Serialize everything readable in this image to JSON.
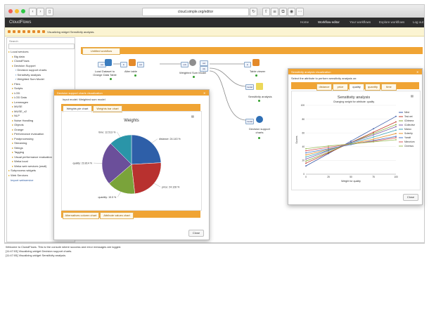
{
  "browser": {
    "url": "cloud.simple.org/editor"
  },
  "app": {
    "brand": "CloudFlows",
    "nav": [
      "Home",
      "Workflow editor",
      "Your workflows",
      "Explore workflows",
      "Log out"
    ],
    "status": "Visualizing widget Sensitivity analysis."
  },
  "sidebar": {
    "search_label": "Search",
    "tree": [
      {
        "label": "Local services",
        "level": 0
      },
      {
        "label": "Big data",
        "level": 1
      },
      {
        "label": "ClowdFlows",
        "level": 1
      },
      {
        "label": "Decision Support",
        "level": 1
      },
      {
        "label": "Decision support charts",
        "level": 2
      },
      {
        "label": "Sensitivity analysis",
        "level": 2
      },
      {
        "label": "Weighted Sum Model",
        "level": 2
      },
      {
        "label": "Files",
        "level": 1
      },
      {
        "label": "Scripts",
        "level": 1
      },
      {
        "label": "LOD",
        "level": 1
      },
      {
        "label": "LOD Data",
        "level": 1
      },
      {
        "label": "Lemmagen",
        "level": 1
      },
      {
        "label": "MUSE",
        "level": 1
      },
      {
        "label": "MUSE_v2",
        "level": 1
      },
      {
        "label": "NLP",
        "level": 1
      },
      {
        "label": "Noise Handling",
        "level": 1
      },
      {
        "label": "Objects",
        "level": 1
      },
      {
        "label": "Orange",
        "level": 1
      },
      {
        "label": "Performance evaluation",
        "level": 1
      },
      {
        "label": "Postprocessing",
        "level": 1
      },
      {
        "label": "Streaming",
        "level": 1
      },
      {
        "label": "Strings",
        "level": 1
      },
      {
        "label": "Tagging",
        "level": 1
      },
      {
        "label": "Visual performance evaluation",
        "level": 1
      },
      {
        "label": "Weka local",
        "level": 1
      },
      {
        "label": "Weka web services (wsdl)",
        "level": 1
      },
      {
        "label": "Subprocess widgets",
        "level": 0
      },
      {
        "label": "Web Services",
        "level": 0
      }
    ],
    "import_link": "Import webservice"
  },
  "workflow": {
    "tab": "Untitled workflow",
    "nodes": [
      {
        "label": "Load Dataset to Orange Data Table",
        "color": "#3b7dbf"
      },
      {
        "label": "Alter table",
        "color": "#e48a2a"
      },
      {
        "label": "Weighted Sum Model",
        "color": "#8e8e8e"
      },
      {
        "label": "Table viewer",
        "color": "#e48a2a"
      },
      {
        "label": "Sensitivity analysis",
        "color": "#ecd85a"
      },
      {
        "label": "Decision support charts",
        "color": "#2f6fb5"
      }
    ],
    "ports": {
      "in": "in",
      "out": "out",
      "odt": "odt",
      "ids": "ids",
      "model": "model"
    }
  },
  "charts_dialog": {
    "title": "Decision support charts visualization",
    "subtitle": "Input model: Weighted sum model",
    "tabs": [
      "Weights pie chart",
      "Weights bar chart"
    ],
    "bottom_tabs": [
      "Alternatives column chart",
      "Attribute values chart"
    ],
    "close": "Close",
    "pie_title": "Weights",
    "chart_data": {
      "type": "pie",
      "title": "Weights",
      "slices": [
        {
          "name": "distance",
          "value": 24.1,
          "label": "distance: 24.143 %",
          "color": "#2e5fa8"
        },
        {
          "name": "price",
          "value": 24.1,
          "label": "price: 24.128 %",
          "color": "#b8312f"
        },
        {
          "name": "quantity",
          "value": 15.5,
          "label": "quantity: 15.5 %",
          "color": "#7aa33a"
        },
        {
          "name": "quality",
          "value": 23.8,
          "label": "quality: 23.814 %",
          "color": "#6b4f9a"
        },
        {
          "name": "time",
          "value": 12.5,
          "label": "time: 12.513 %",
          "color": "#2a95a8"
        }
      ]
    }
  },
  "sensitivity_dialog": {
    "title": "Sensitivity analysis visualization",
    "prompt": "Select the attribute to perform sensitivity analysis on:",
    "attributes": [
      "distance",
      "price",
      "quality",
      "quantity",
      "time"
    ],
    "selected": "quality",
    "chart_title": "Sensitivity analysis",
    "chart_subtitle": "Changing weight for attribute: quality",
    "close": "Close",
    "chart_data": {
      "type": "line",
      "title": "Sensitivity analysis",
      "subtitle": "Changing weight for attribute: quality",
      "xlabel": "Weight for quality",
      "ylabel": "Scores",
      "x": [
        0,
        25,
        50,
        75,
        100
      ],
      "xlim": [
        0,
        100
      ],
      "ylim": [
        0,
        100
      ],
      "yticks": [
        0,
        20,
        40,
        60,
        80,
        100
      ],
      "series": [
        {
          "name": "Mind",
          "color": "#3b5ba8",
          "values": [
            12,
            30,
            48,
            66,
            84
          ]
        },
        {
          "name": "Test.net",
          "color": "#c0392b",
          "values": [
            16,
            31,
            46,
            61,
            76
          ]
        },
        {
          "name": "iChimera",
          "color": "#8aa93a",
          "values": [
            19,
            32,
            46,
            59,
            72
          ]
        },
        {
          "name": "iCollective",
          "color": "#7d5ba6",
          "values": [
            22,
            34,
            46,
            57,
            69
          ]
        },
        {
          "name": "Manco",
          "color": "#3aa3b5",
          "values": [
            25,
            35,
            45,
            54,
            64
          ]
        },
        {
          "name": "Scientip",
          "color": "#e4902f",
          "values": [
            28,
            36,
            44,
            51,
            59
          ]
        },
        {
          "name": "Yandri",
          "color": "#4a78c9",
          "values": [
            31,
            37,
            43,
            49,
            55
          ]
        },
        {
          "name": "Mimorium",
          "color": "#d65a5a",
          "values": [
            34,
            39,
            44,
            48,
            53
          ]
        },
        {
          "name": "Cinemus",
          "color": "#9bbb59",
          "values": [
            37,
            41,
            44,
            47,
            50
          ]
        }
      ]
    }
  },
  "console": {
    "lines": [
      "Welcome to ClowdFlows. This is the console where success and error messages are logged.",
      "[11:47:03] Visualizing widget Decision support charts.",
      "[11:47:05] Visualizing widget Sensitivity analysis."
    ]
  }
}
